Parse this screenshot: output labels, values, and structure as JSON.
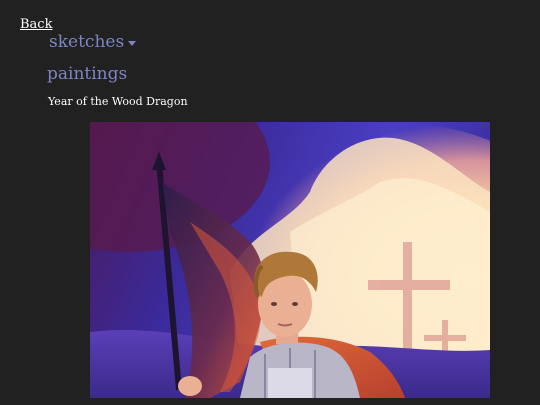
{
  "nav": {
    "back_label": "Back",
    "sketches_label": "sketches",
    "paintings_label": "paintings"
  },
  "page": {
    "subtitle": "Year of the Wood Dragon"
  },
  "colors": {
    "background": "#212121",
    "nav_link": "#7d86c4",
    "text": "#ffffff"
  }
}
